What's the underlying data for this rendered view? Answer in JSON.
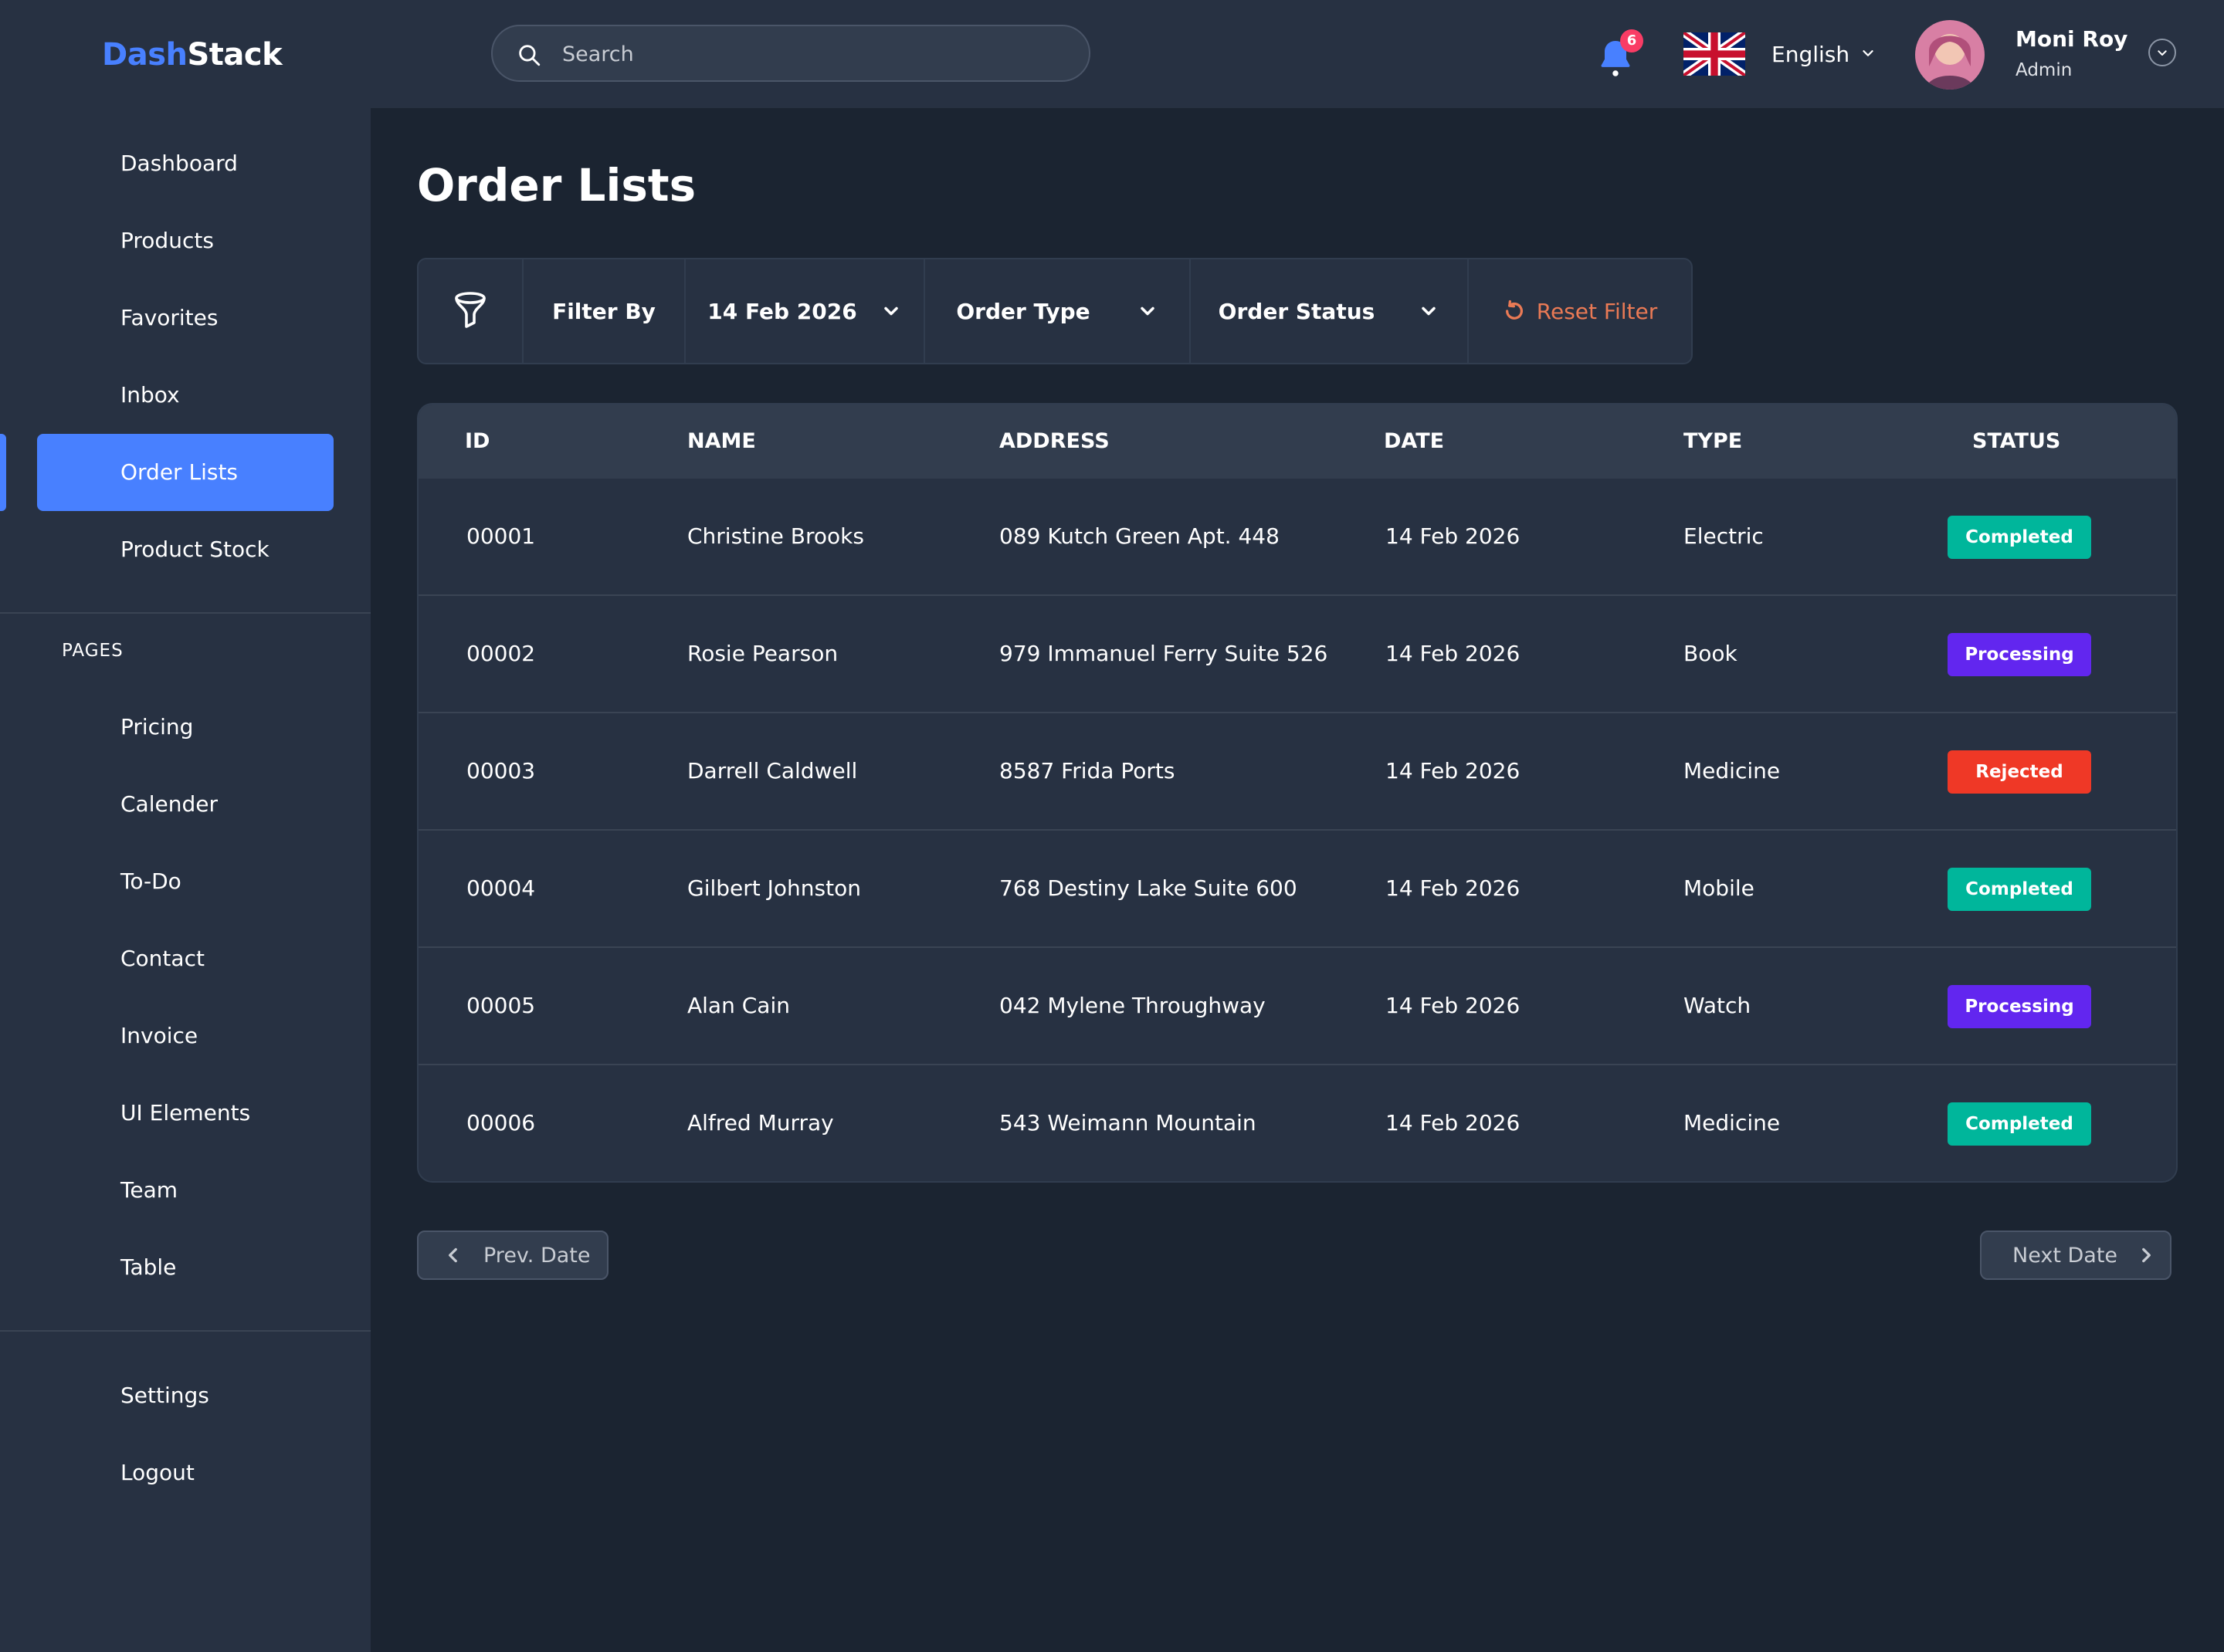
{
  "brand": {
    "part1": "Dash",
    "part2": "Stack"
  },
  "sidebar": {
    "main_items": [
      {
        "label": "Dashboard"
      },
      {
        "label": "Products"
      },
      {
        "label": "Favorites"
      },
      {
        "label": "Inbox"
      },
      {
        "label": "Order Lists",
        "active": true
      },
      {
        "label": "Product Stock"
      }
    ],
    "pages_label": "PAGES",
    "page_items": [
      {
        "label": "Pricing"
      },
      {
        "label": "Calender"
      },
      {
        "label": "To-Do"
      },
      {
        "label": "Contact"
      },
      {
        "label": "Invoice"
      },
      {
        "label": "UI Elements"
      },
      {
        "label": "Team"
      },
      {
        "label": "Table"
      }
    ],
    "bottom_items": [
      {
        "label": "Settings"
      },
      {
        "label": "Logout"
      }
    ]
  },
  "topbar": {
    "search_placeholder": "Search",
    "notification_count": "6",
    "language": "English",
    "user": {
      "name": "Moni Roy",
      "role": "Admin"
    }
  },
  "page": {
    "title": "Order Lists"
  },
  "filters": {
    "filter_by": "Filter By",
    "date": "14 Feb 2026",
    "order_type": "Order Type",
    "order_status": "Order Status",
    "reset": "Reset Filter"
  },
  "table": {
    "headers": [
      "ID",
      "NAME",
      "ADDRESS",
      "DATE",
      "TYPE",
      "STATUS"
    ],
    "rows": [
      {
        "id": "00001",
        "name": "Christine Brooks",
        "address": "089 Kutch Green Apt. 448",
        "date": "14 Feb 2026",
        "type": "Electric",
        "status": "Completed"
      },
      {
        "id": "00002",
        "name": "Rosie Pearson",
        "address": "979 Immanuel Ferry Suite 526",
        "date": "14 Feb 2026",
        "type": "Book",
        "status": "Processing"
      },
      {
        "id": "00003",
        "name": "Darrell Caldwell",
        "address": "8587 Frida Ports",
        "date": "14 Feb 2026",
        "type": "Medicine",
        "status": "Rejected"
      },
      {
        "id": "00004",
        "name": "Gilbert Johnston",
        "address": "768 Destiny Lake Suite 600",
        "date": "14 Feb 2026",
        "type": "Mobile",
        "status": "Completed"
      },
      {
        "id": "00005",
        "name": "Alan Cain",
        "address": "042 Mylene Throughway",
        "date": "14 Feb 2026",
        "type": "Watch",
        "status": "Processing"
      },
      {
        "id": "00006",
        "name": "Alfred Murray",
        "address": "543 Weimann Mountain",
        "date": "14 Feb 2026",
        "type": "Medicine",
        "status": "Completed"
      }
    ]
  },
  "status_colors": {
    "Completed": "#00b69b",
    "Processing": "#6226ef",
    "Rejected": "#ef3826"
  },
  "pagination": {
    "prev": "Prev. Date",
    "next": "Next Date"
  },
  "icons": [
    "search-icon",
    "bell-icon",
    "uk-flag-icon",
    "chevron-down-icon",
    "funnel-icon",
    "reset-icon",
    "chevron-left-icon",
    "chevron-right-icon"
  ]
}
